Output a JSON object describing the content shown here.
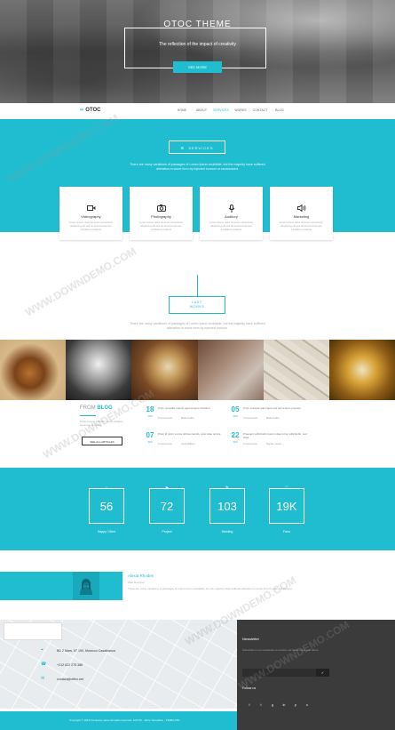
{
  "hero": {
    "title": "OTOC THEME",
    "subtitle": "The reflection of the impact of creativity",
    "button": "SEE MORE"
  },
  "nav": {
    "logo": "OTOC",
    "items": [
      "HOME",
      "ABOUT",
      "SERVICES",
      "WORKS",
      "CONTACT",
      "BLOG"
    ],
    "active": "SERVICES"
  },
  "services": {
    "heading": "SERVICES",
    "desc": "There are many variations of passages of Lorem Ipsum available, but the majority have suffered alteration in some form by injected humour or randomised.",
    "cards": [
      {
        "icon": "video-icon",
        "title": "Videography",
        "desc": "Lorem Ipsum dolor sit amet consectetur adipiscing elit sed do eiusmod tempor incididunt ut labore"
      },
      {
        "icon": "camera-icon",
        "title": "Photography",
        "desc": "Lorem Ipsum dolor sit amet consectetur adipiscing elit sed do eiusmod tempor incididunt ut labore"
      },
      {
        "icon": "microphone-icon",
        "title": "Auditory",
        "desc": "Lorem Ipsum dolor sit amet consectetur adipiscing elit sed do eiusmod tempor incididunt ut labore"
      },
      {
        "icon": "speaker-icon",
        "title": "Marketing",
        "desc": "Lorem Ipsum dolor sit amet consectetur adipiscing elit sed do eiusmod tempor incididunt ut labore"
      }
    ]
  },
  "works": {
    "heading_line1": "LAST",
    "heading_line2": "WORKS",
    "desc": "There are many variations of passages of Lorem Ipsum available, but the majority have suffered alteration in some form by injected humour."
  },
  "blog": {
    "title_prefix": "FROM",
    "title_main": "BLOG",
    "desc": "Pellentesque habitant morbi tristique senectus et netus",
    "button": "SEE ALL ARTICLES",
    "posts": [
      {
        "day": "18",
        "month": "JAN",
        "title": "Proin convallis mauris eget tempus tincidunt",
        "comments": "5 Comments",
        "author": "Maria Keller"
      },
      {
        "day": "05",
        "month": "JAN",
        "title": "Proin volutpat quis ligula sed fermentum posuere",
        "comments": "3 Comments",
        "author": "Maria Keller"
      },
      {
        "day": "07",
        "month": "JAN",
        "title": "Proin id tortor a eros ultrices iaculis, quis vitae ornare",
        "comments": "0 Comments",
        "author": "Anna Wilson"
      },
      {
        "day": "22",
        "month": "JAN",
        "title": "Praesent sollicitudin ipsum vitae tortor sollicitudin, sed vitae",
        "comments": "0 Comments",
        "author": "Sophie Jones"
      }
    ]
  },
  "counters": [
    {
      "value": "56",
      "label": "Happy Client",
      "icon": "home-icon"
    },
    {
      "value": "72",
      "label": "Project",
      "icon": "send-icon"
    },
    {
      "value": "103",
      "label": "Meeting",
      "icon": "pen-icon"
    },
    {
      "value": "19K",
      "label": "Fans",
      "icon": "heart-icon"
    }
  ],
  "team": {
    "name": "Alexia Rhodes",
    "role": "Web Designer",
    "desc": "There are many variations of passages of Lorem Ipsum available, but the majority have suffered alteration in some form by injected humour."
  },
  "contact": {
    "address": "BD 2 Mars, N° 190, Morocco Casablanca",
    "phone": "+212 622 275 386",
    "email": "contact@reflex.net"
  },
  "newsletter": {
    "title": "Newsletter",
    "desc": "Subscribe to our newsletter to receive our latest news and offers.",
    "follow": "Follow us"
  },
  "footer": {
    "copyright": "Copyright © 2015 Company name All rights reserved. FOTOC - More Templates - TEMPLATE"
  },
  "colors": {
    "accent": "#20bdd0",
    "dark": "#3b3b3b"
  },
  "watermark": "WWW.DOWNDEMO.COM"
}
